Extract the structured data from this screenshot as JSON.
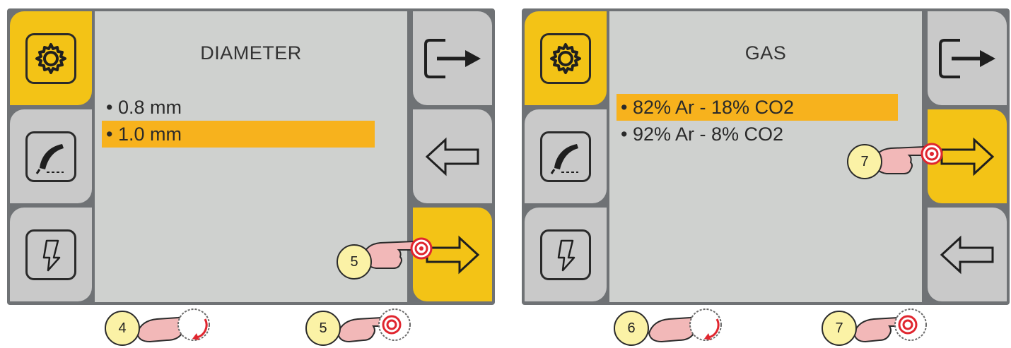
{
  "panels": [
    {
      "title": "DIAMETER",
      "items": [
        "• 0.8 mm",
        "• 1.0 mm"
      ],
      "selected_index": 1,
      "left_buttons": [
        "settings-gear-icon",
        "welding-torch-icon",
        "wire-feed-icon"
      ],
      "right_buttons": [
        "exit-icon",
        "arrow-left-icon",
        "arrow-right-icon"
      ],
      "active_right": 2,
      "onscreen_step": "5",
      "below_steps": [
        "4",
        "5"
      ]
    },
    {
      "title": "GAS",
      "items": [
        "• 82% Ar - 18% CO2",
        "• 92% Ar - 8% CO2"
      ],
      "selected_index": 0,
      "left_buttons": [
        "settings-gear-icon",
        "welding-torch-icon",
        "wire-feed-icon"
      ],
      "right_buttons": [
        "exit-icon",
        "arrow-right-icon",
        "arrow-left-icon"
      ],
      "active_right": 1,
      "onscreen_step": "7",
      "below_steps": [
        "6",
        "7"
      ]
    }
  ],
  "colors": {
    "screen_frame": "#6f7275",
    "button": "#c9c9c9",
    "button_active": "#f3c316",
    "content_bg": "#cfd1cf",
    "selection": "#f7b21d",
    "badge": "#fbf2a6",
    "hand": "#f2b8b8",
    "knob_ring": "#e0262f"
  }
}
